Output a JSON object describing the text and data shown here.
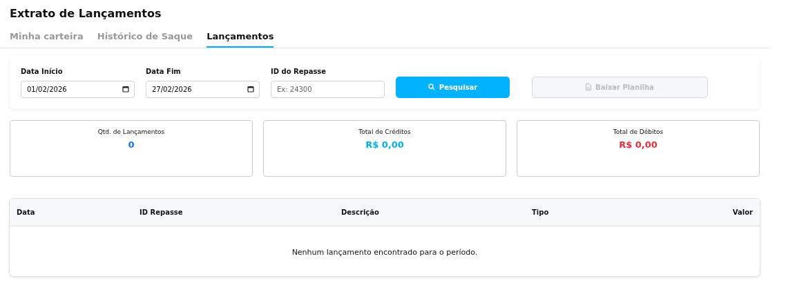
{
  "title": "Extrato de Lançamentos",
  "tabs": [
    {
      "label": "Minha carteira",
      "selected": false
    },
    {
      "label": "Histórico de Saque",
      "selected": false
    },
    {
      "label": "Lançamentos",
      "selected": true
    }
  ],
  "filters": [
    {
      "kind": "date",
      "label": "Data Início",
      "value": "01/02/2026"
    },
    {
      "kind": "date",
      "label": "Data Fim",
      "value": "27/02/2026"
    },
    {
      "kind": "text",
      "label": "ID do Repasse",
      "placeholder": "Ex: 24300"
    }
  ],
  "buttons": [
    {
      "kind": "search",
      "label": "Pesquisar",
      "disabled": false
    },
    {
      "kind": "download",
      "label": "Baixar Planilha",
      "disabled": true
    }
  ],
  "stats": [
    {
      "label": "Qtd. de Lançamentos",
      "value": "0",
      "color": "#1a6ef5"
    },
    {
      "label": "Total de Créditos",
      "value": "R$ 0,00",
      "color": "#00aeef"
    },
    {
      "label": "Total de Débitos",
      "value": "R$ 0,00",
      "color": "#e0323c"
    }
  ],
  "table": {
    "columns": [
      "Data",
      "ID Repasse",
      "Descrição",
      "Tipo",
      "Valor"
    ],
    "empty_message": "Nenhum lançamento encontrado para o período."
  }
}
